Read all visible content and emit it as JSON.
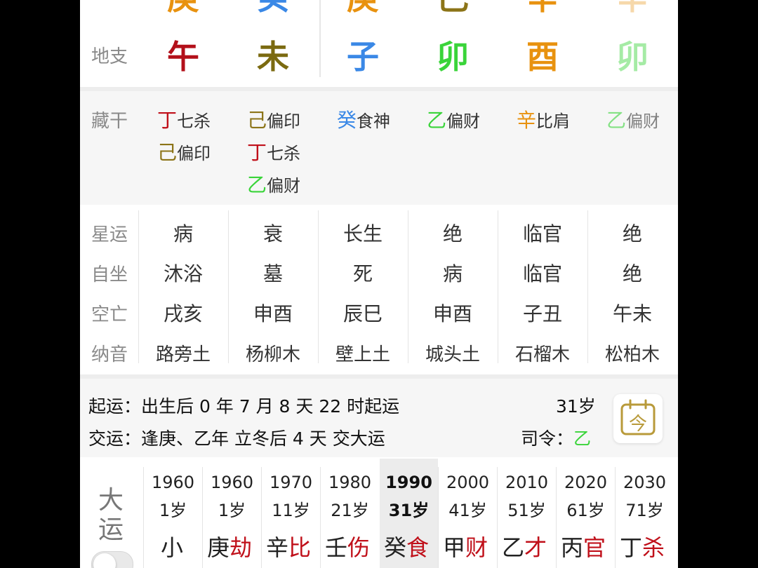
{
  "colors": {
    "geng": "#e8920f",
    "gui": "#3a88e6",
    "ji": "#8c7418",
    "xin": "#e8920f",
    "wu": "#b3101a",
    "wei": "#7b6a10",
    "zi": "#3a88e6",
    "mao": "#3ad43a",
    "you": "#e8920f",
    "ding": "#c0101a",
    "yi": "#3ad43a",
    "red": "#c0101a",
    "accent": "#b89a3a"
  },
  "top_stems": [
    "庚",
    "癸",
    "庚",
    "己",
    "辛",
    "辛"
  ],
  "dizhi": {
    "label": "地支",
    "branches": [
      "午",
      "未",
      "子",
      "卯",
      "酉",
      "卯"
    ]
  },
  "canggan": {
    "label": "藏干",
    "columns": [
      [
        {
          "stem": "丁",
          "god": "七杀"
        },
        {
          "stem": "己",
          "god": "偏印"
        }
      ],
      [
        {
          "stem": "己",
          "god": "偏印"
        },
        {
          "stem": "丁",
          "god": "七杀"
        },
        {
          "stem": "乙",
          "god": "偏财"
        }
      ],
      [
        {
          "stem": "癸",
          "god": "食神"
        }
      ],
      [
        {
          "stem": "乙",
          "god": "偏财"
        }
      ],
      [
        {
          "stem": "辛",
          "god": "比肩"
        }
      ],
      [
        {
          "stem": "乙",
          "god": "偏财"
        }
      ]
    ]
  },
  "rows": [
    {
      "label": "星运",
      "values": [
        "病",
        "衰",
        "长生",
        "绝",
        "临官",
        "绝"
      ]
    },
    {
      "label": "自坐",
      "values": [
        "沐浴",
        "墓",
        "死",
        "病",
        "临官",
        "绝"
      ]
    },
    {
      "label": "空亡",
      "values": [
        "戌亥",
        "申酉",
        "辰巳",
        "申酉",
        "子丑",
        "午未"
      ]
    },
    {
      "label": "纳音",
      "values": [
        "路旁土",
        "杨柳木",
        "壁上土",
        "城头土",
        "石榴木",
        "松柏木"
      ]
    }
  ],
  "qiyun": {
    "line1": "起运：出生后 0 年 7 月 8 天 22 时起运",
    "age": "31岁",
    "line2": "交运：逢庚、乙年 立冬后 4 天 交大运",
    "siling_label": "司令：",
    "siling_value": "乙",
    "jin_button": "今"
  },
  "dayun": {
    "label_top": "大",
    "label_bottom": "运",
    "columns": [
      {
        "year": "1960",
        "age": "1岁",
        "stem": "小",
        "shishen": ""
      },
      {
        "year": "1960",
        "age": "1岁",
        "stem": "庚",
        "shishen": "劫"
      },
      {
        "year": "1970",
        "age": "11岁",
        "stem": "辛",
        "shishen": "比"
      },
      {
        "year": "1980",
        "age": "21岁",
        "stem": "壬",
        "shishen": "伤"
      },
      {
        "year": "1990",
        "age": "31岁",
        "stem": "癸",
        "shishen": "食"
      },
      {
        "year": "2000",
        "age": "41岁",
        "stem": "甲",
        "shishen": "财"
      },
      {
        "year": "2010",
        "age": "51岁",
        "stem": "乙",
        "shishen": "才"
      },
      {
        "year": "2020",
        "age": "61岁",
        "stem": "丙",
        "shishen": "官"
      },
      {
        "year": "2030",
        "age": "71岁",
        "stem": "丁",
        "shishen": "杀"
      }
    ]
  }
}
